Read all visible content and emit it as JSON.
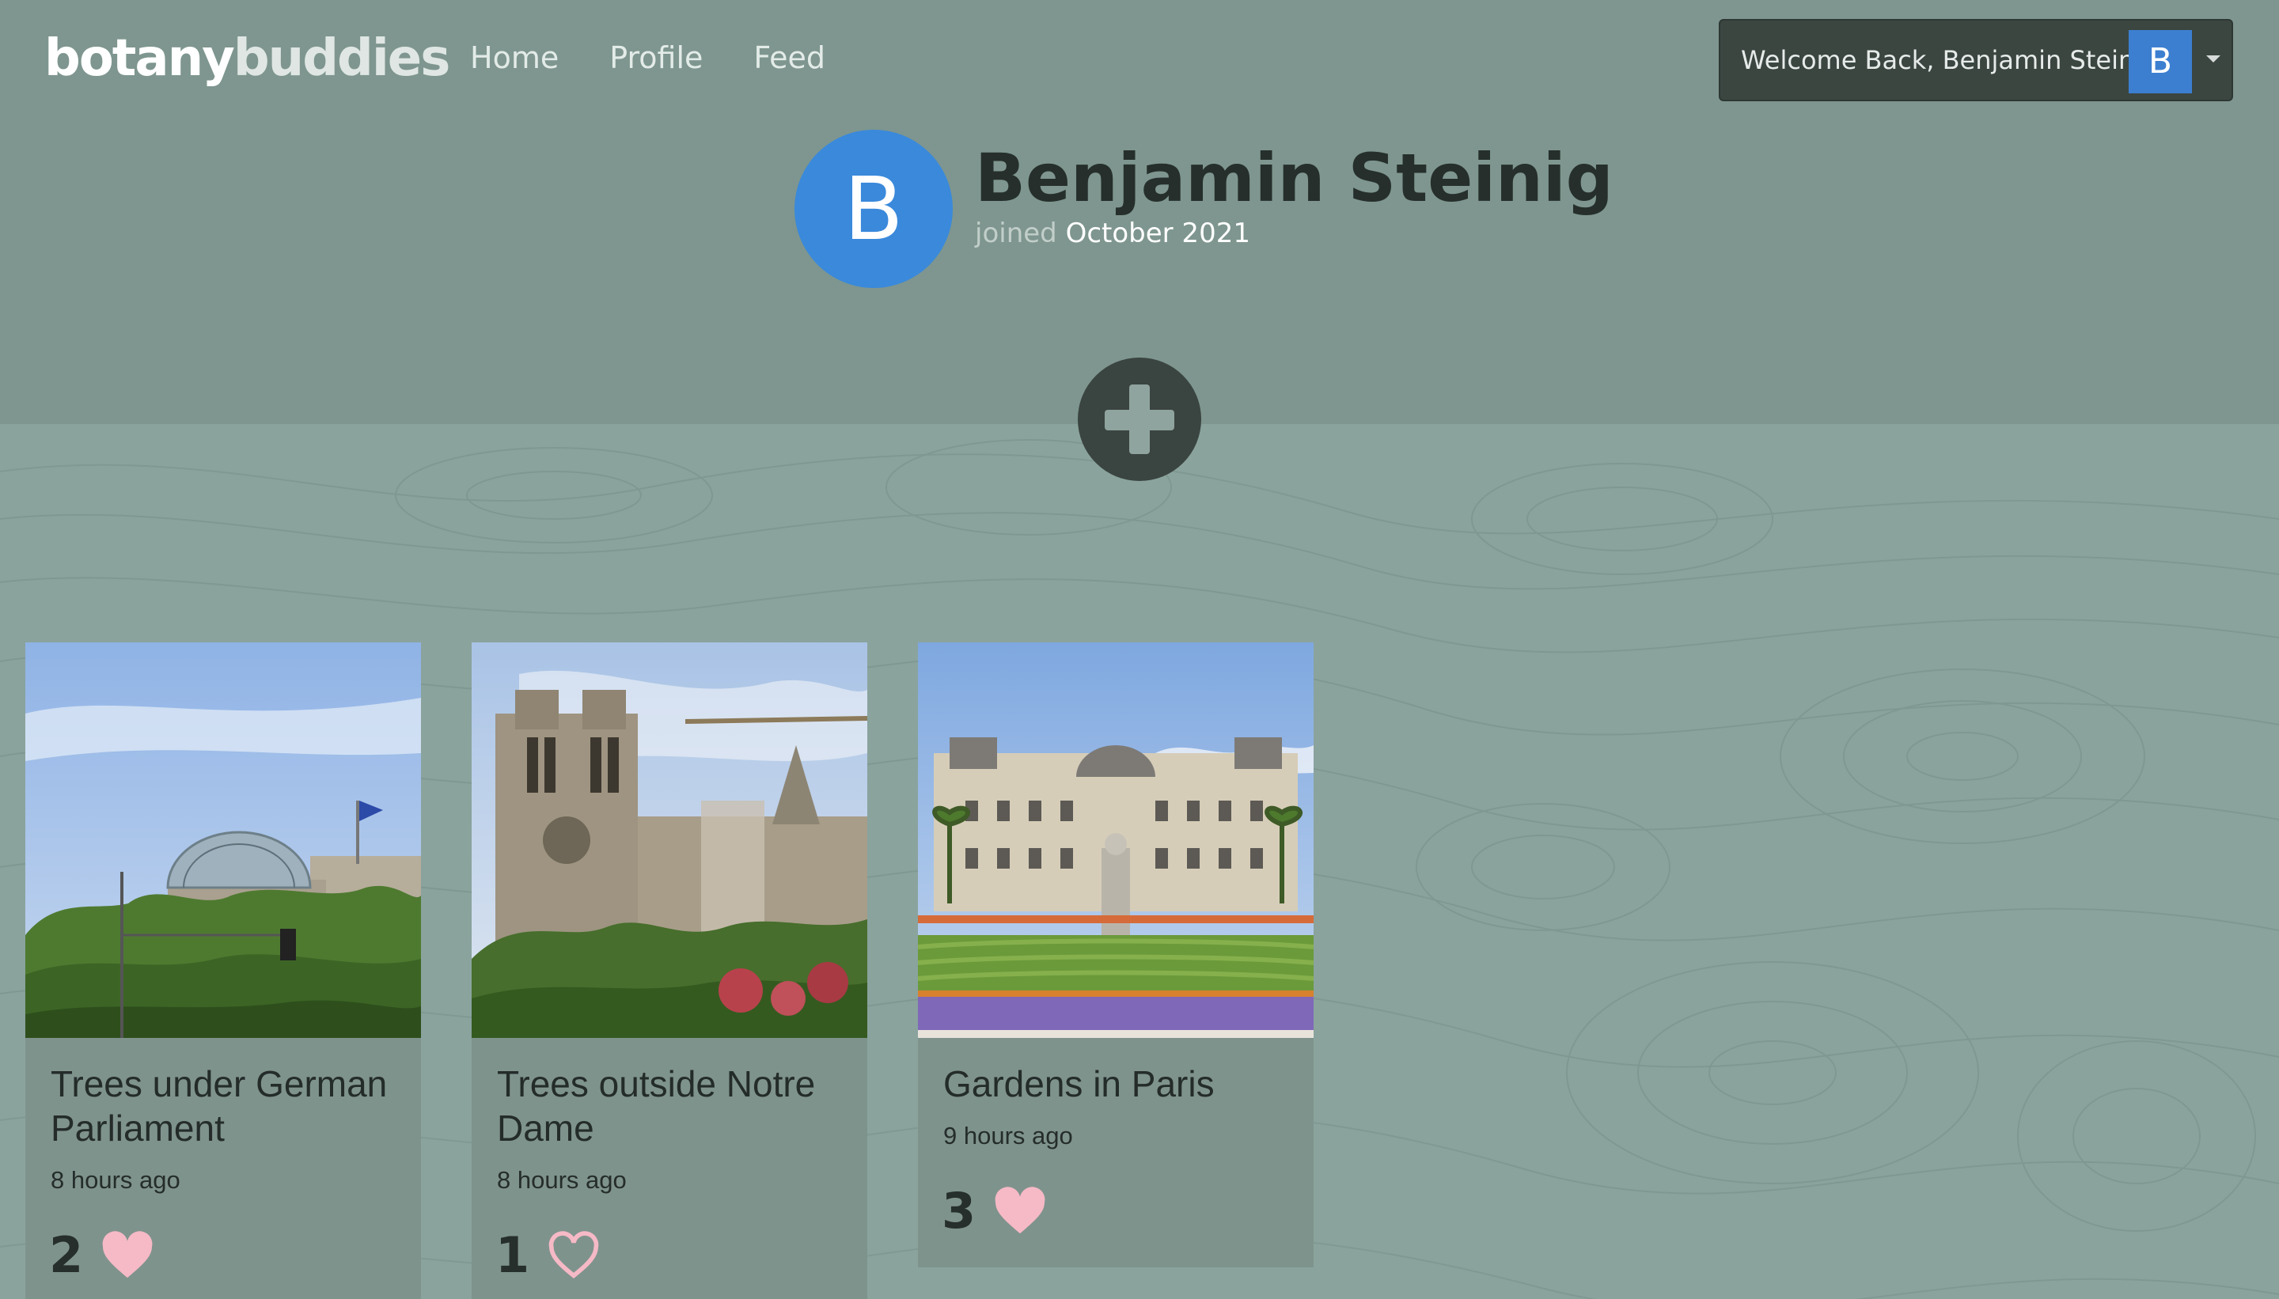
{
  "app": {
    "brand_part1": "botany",
    "brand_part2": "buddies"
  },
  "nav": {
    "items": [
      {
        "label": "Home"
      },
      {
        "label": "Profile"
      },
      {
        "label": "Feed"
      }
    ]
  },
  "user_menu": {
    "welcome": "Welcome Back, Benjamin Steinig",
    "avatar_initial": "B"
  },
  "profile": {
    "avatar_initial": "B",
    "name": "Benjamin Steinig",
    "joined_label": "joined",
    "joined_date": "October 2021"
  },
  "add_post": {
    "icon": "plus-icon"
  },
  "posts": [
    {
      "title": "Trees under German Parliament",
      "time": "8 hours ago",
      "likes": "2",
      "liked": true
    },
    {
      "title": "Trees outside Notre Dame",
      "time": "8 hours ago",
      "likes": "1",
      "liked": false
    },
    {
      "title": "Gardens in Paris",
      "time": "9 hours ago",
      "likes": "3",
      "liked": true
    }
  ],
  "colors": {
    "header_bg": "#7e968f",
    "topo_bg": "#8aa39d",
    "avatar_blue": "#3a89db",
    "heart_pink": "#f6b9c6",
    "dark": "#3a4440"
  }
}
